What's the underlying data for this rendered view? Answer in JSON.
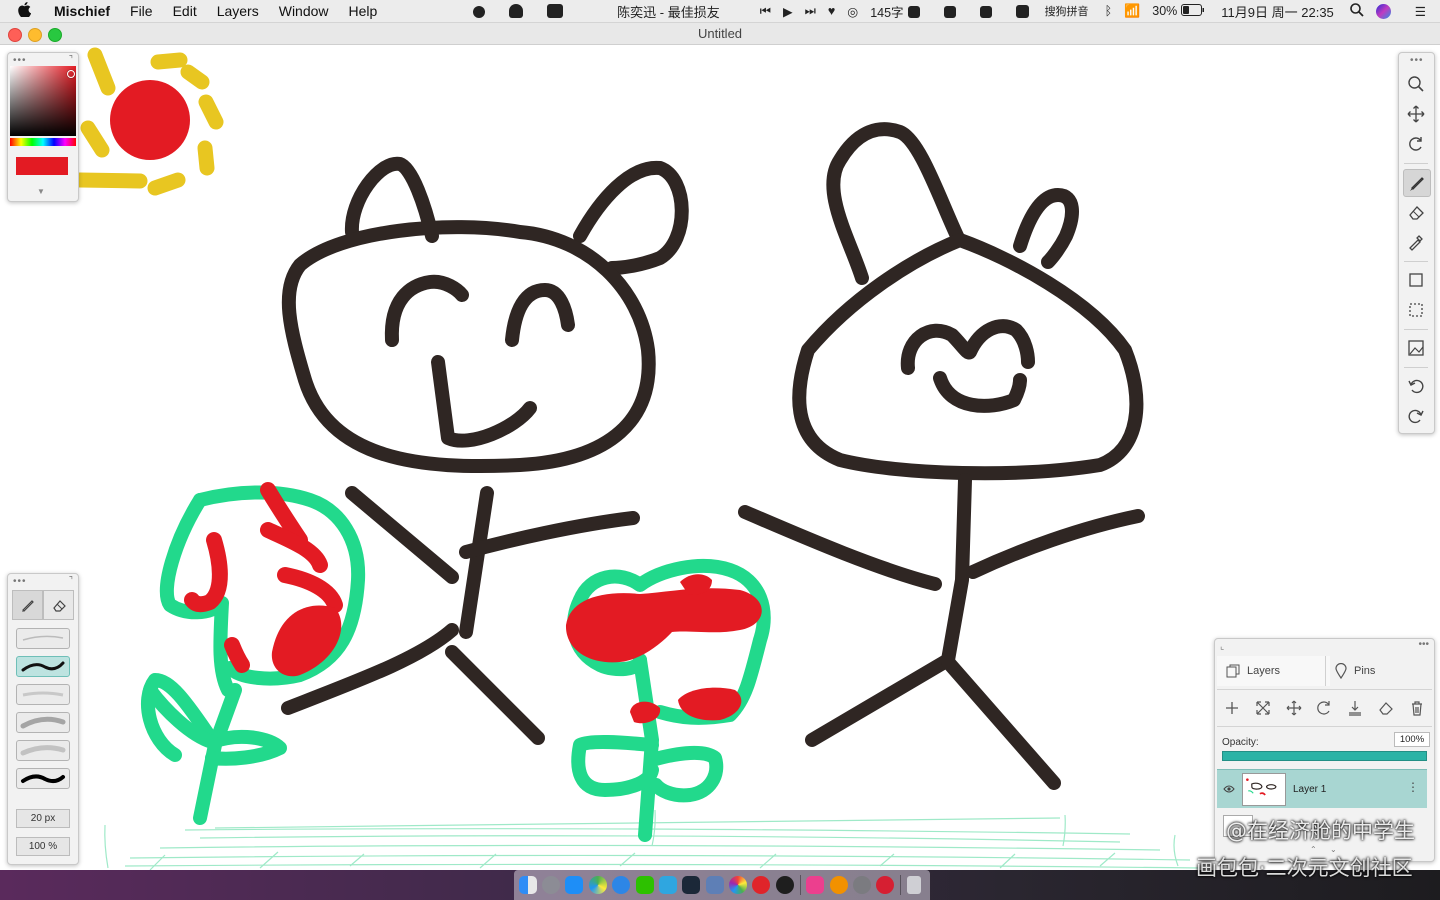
{
  "menubar": {
    "apple": "",
    "app_name": "Mischief",
    "menus": [
      "File",
      "Edit",
      "Layers",
      "Window",
      "Help"
    ],
    "now_playing": "陈奕迅 - 最佳损友",
    "word_count": "145字",
    "input_method": "搜狗拼音",
    "battery": "30%",
    "datetime": "11月9日 周一  22:35"
  },
  "window": {
    "title": "Untitled"
  },
  "color_panel": {
    "current_color": "#e31b23"
  },
  "brush_panel": {
    "size": "20 px",
    "opacity": "100 %",
    "presets": [
      "pencil-thin",
      "marker",
      "soft-light",
      "airbrush",
      "soft-medium",
      "ink"
    ]
  },
  "right_toolbar": {
    "tools": [
      "zoom-icon",
      "pan-icon",
      "rotate-icon",
      "brush-icon",
      "eraser-icon",
      "eyedropper-icon",
      "shape-icon",
      "selection-icon",
      "image-icon",
      "undo-icon",
      "redo-icon"
    ]
  },
  "layers_panel": {
    "tabs": [
      "Layers",
      "Pins"
    ],
    "opacity_label": "Opacity:",
    "opacity_value": "100%",
    "opacity": 1.0,
    "layers": [
      {
        "name": "Layer 1"
      }
    ]
  },
  "watermark": {
    "line1": "@在经济舱的中学生",
    "line2": "画包包·二次元文创社区"
  },
  "colors": {
    "ink": "#2f2623",
    "red": "#e31b23",
    "green": "#22d98c",
    "sun": "#e8c621",
    "accent": "#2bb3a6"
  }
}
